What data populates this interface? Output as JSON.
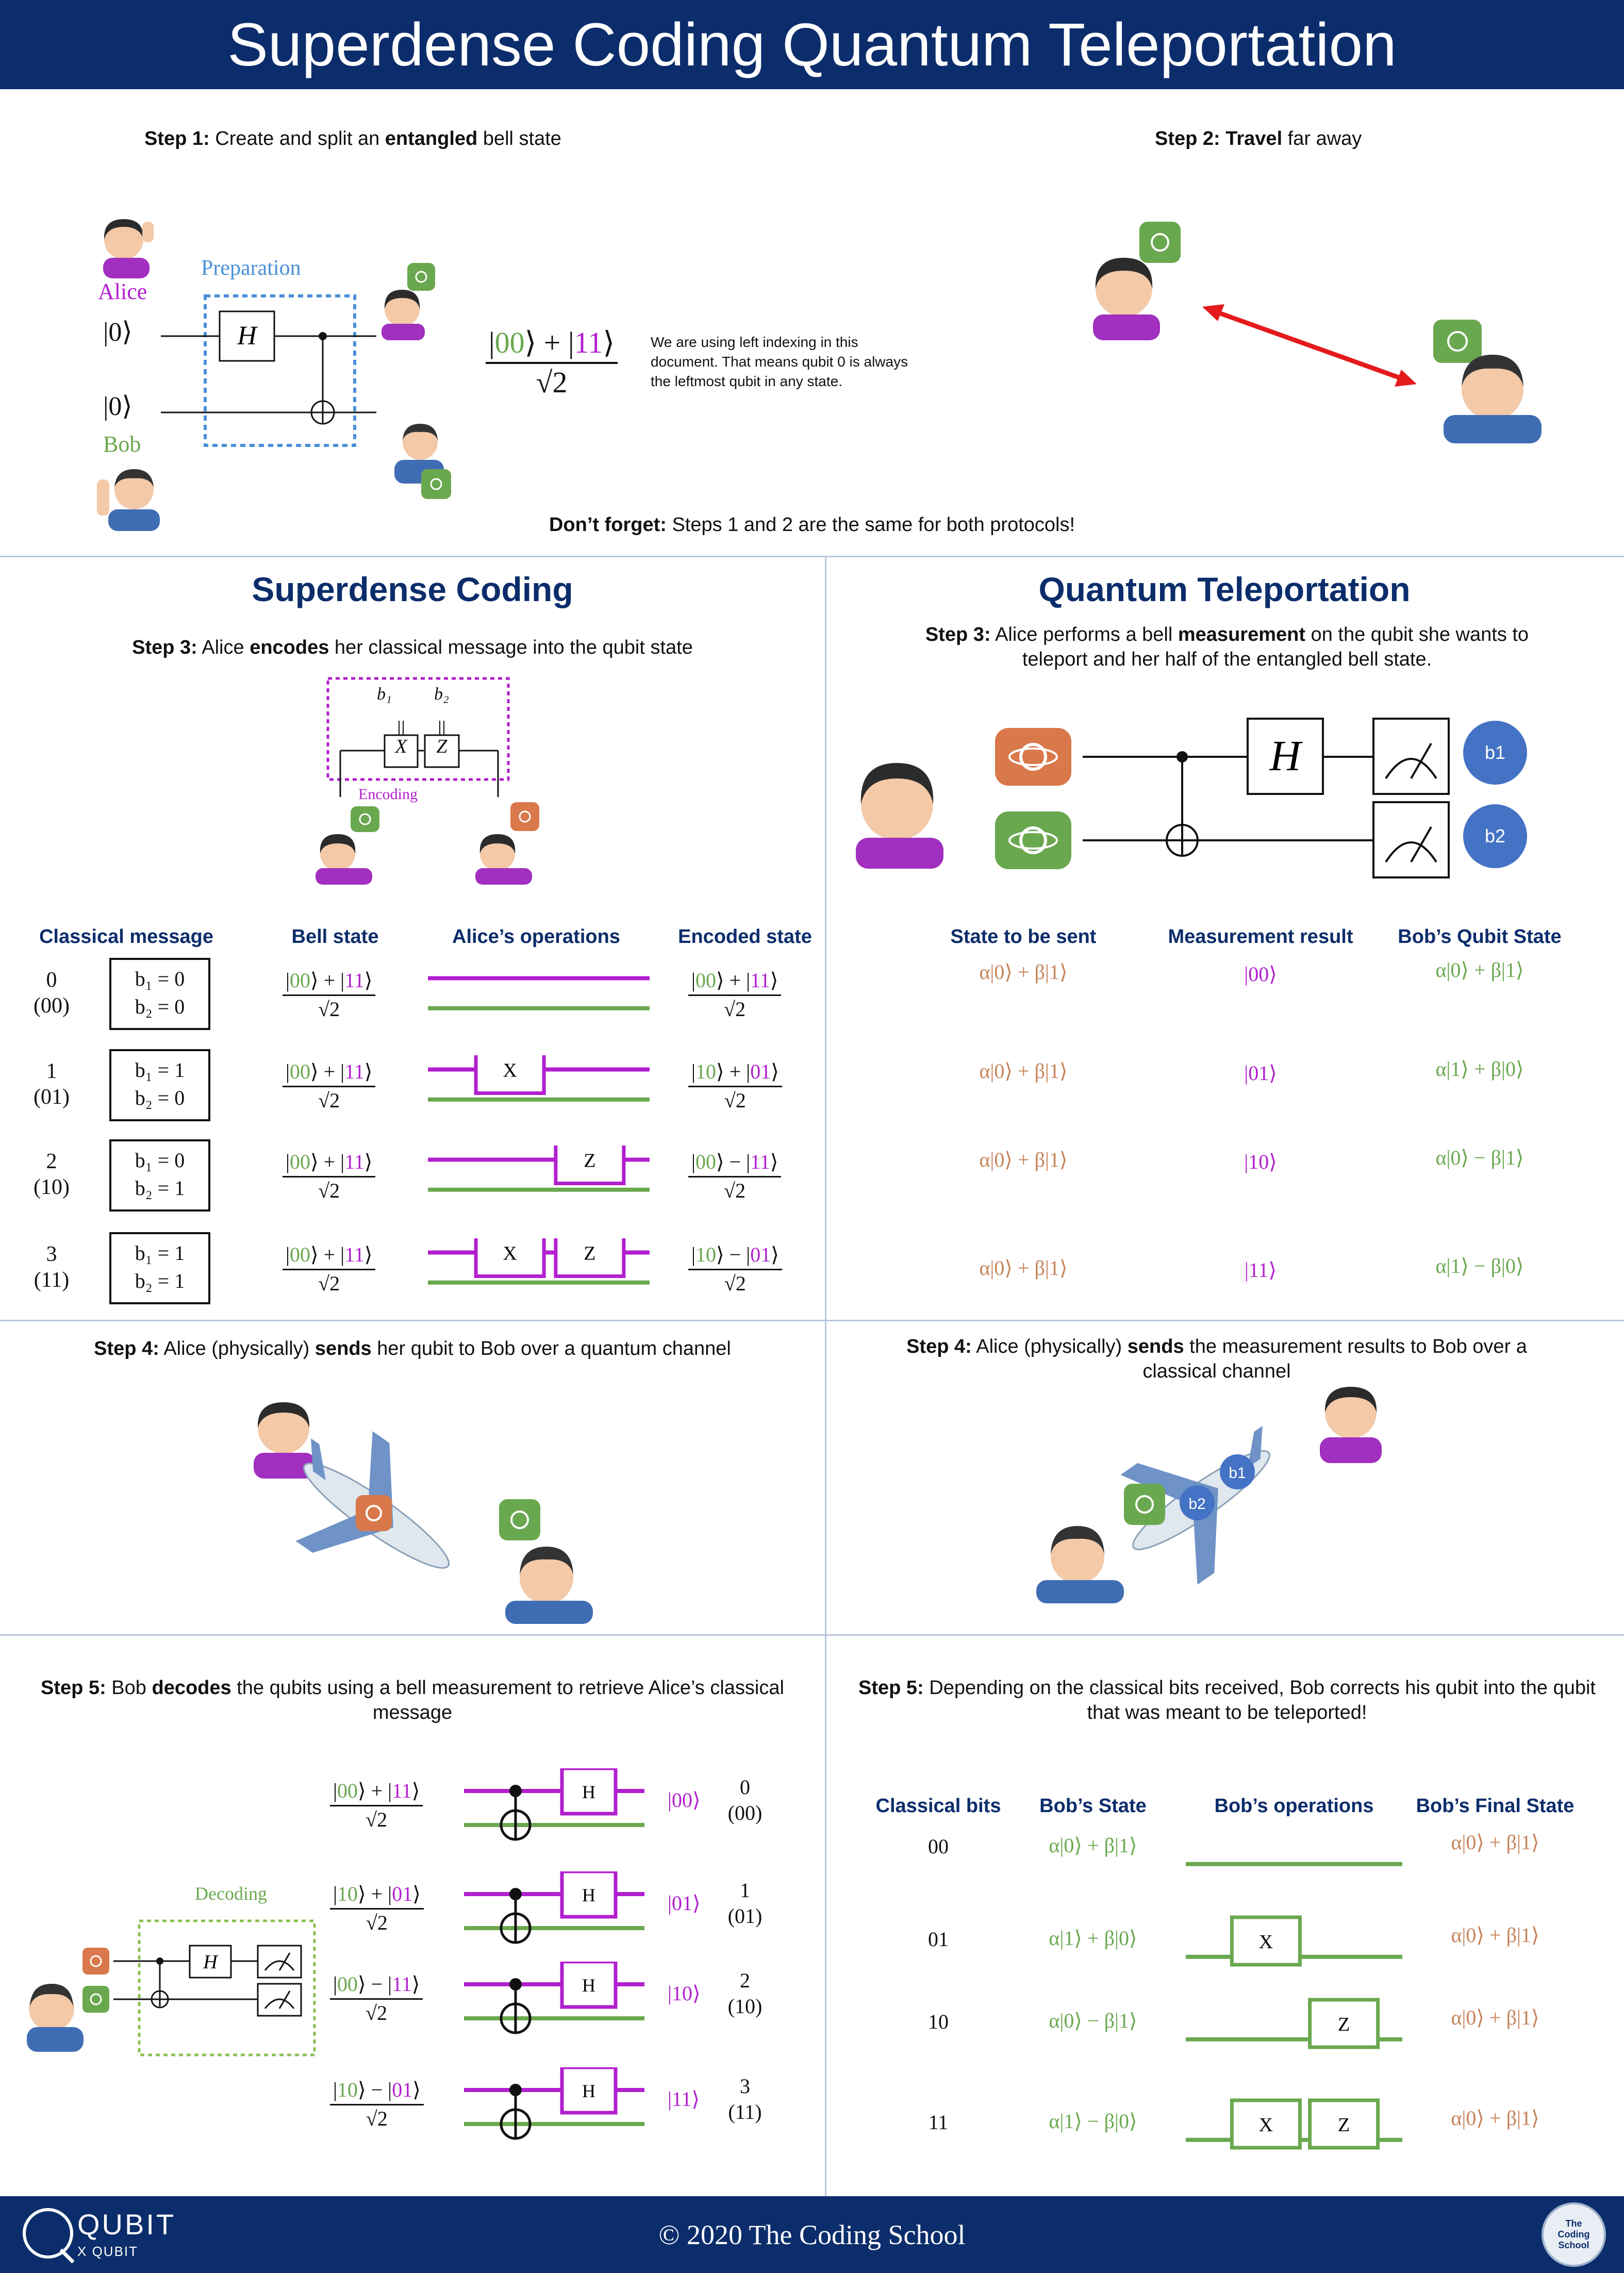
{
  "title": "Superdense Coding Quantum Teleportation",
  "top": {
    "step1": {
      "label": "Step 1:",
      "pre": " Create and split an ",
      "bold": "entangled",
      "post": " bell state"
    },
    "step2": {
      "label": "Step 2:",
      "bold": " Travel",
      "post": " far away"
    },
    "prep_label": "Preparation",
    "alice": "Alice",
    "bob": "Bob",
    "ket0a": "|0⟩",
    "ket0b": "|0⟩",
    "gate_h": "H",
    "bell_num_parts": [
      "|",
      "00",
      "⟩ + |",
      "11",
      "⟩"
    ],
    "bell_den": "√2",
    "indexing_note": "We are using left indexing in this document. That means qubit 0 is always the leftmost qubit in any state.",
    "dont_forget": {
      "bold": "Don’t forget:",
      "text": " Steps 1 and 2 are the same for both protocols!"
    }
  },
  "sdc": {
    "title": "Superdense Coding",
    "step3": {
      "label": "Step 3:",
      "pre": " Alice ",
      "bold": "encodes",
      "post": " her classical message into the qubit state"
    },
    "encoding_label": "Encoding",
    "b1": "b₁",
    "b2": "b₂",
    "gate_x": "X",
    "gate_z": "Z",
    "headers": [
      "Classical message",
      "Bell state",
      "Alice’s operations",
      "Encoded state"
    ],
    "rows": [
      {
        "msg": "0",
        "bits": "(00)",
        "line1": "b₁ = 0",
        "line2": "b₂ = 0",
        "ops": "",
        "enc": [
          "|",
          "00",
          "⟩ + |",
          "11",
          "⟩"
        ]
      },
      {
        "msg": "1",
        "bits": "(01)",
        "line1": "b₁ = 1",
        "line2": "b₂ = 0",
        "ops": "X",
        "enc": [
          "|",
          "10",
          "⟩ + |",
          "01",
          "⟩"
        ]
      },
      {
        "msg": "2",
        "bits": "(10)",
        "line1": "b₁ = 0",
        "line2": "b₂ = 1",
        "ops": "Z",
        "enc": [
          "|",
          "00",
          "⟩ − |",
          "11",
          "⟩"
        ]
      },
      {
        "msg": "3",
        "bits": "(11)",
        "line1": "b₁ = 1",
        "line2": "b₂ = 1",
        "ops": "XZ",
        "enc": [
          "|",
          "10",
          "⟩ − |",
          "01",
          "⟩"
        ]
      }
    ],
    "bell_parts": [
      "|",
      "00",
      "⟩ + |",
      "11",
      "⟩"
    ],
    "step4": {
      "label": "Step 4:",
      "pre": " Alice (physically) ",
      "bold": "sends",
      "post": " her qubit to Bob over a quantum channel"
    },
    "step5": {
      "label": "Step 5:",
      "pre": " Bob ",
      "bold": "decodes",
      "post": " the qubits using a bell measurement to retrieve Alice’s classical message"
    },
    "decoding_label": "Decoding",
    "decode_rows": [
      {
        "state": [
          "|",
          "00",
          "⟩ + |",
          "11",
          "⟩"
        ],
        "result": "|00⟩",
        "msg": "0",
        "bits": "(00)"
      },
      {
        "state": [
          "|",
          "10",
          "⟩ + |",
          "01",
          "⟩"
        ],
        "result": "|01⟩",
        "msg": "1",
        "bits": "(01)"
      },
      {
        "state": [
          "|",
          "00",
          "⟩ − |",
          "11",
          "⟩"
        ],
        "result": "|10⟩",
        "msg": "2",
        "bits": "(10)"
      },
      {
        "state": [
          "|",
          "10",
          "⟩ − |",
          "01",
          "⟩"
        ],
        "result": "|11⟩",
        "msg": "3",
        "bits": "(11)"
      }
    ]
  },
  "qt": {
    "title": "Quantum Teleportation",
    "step3": {
      "label": "Step 3:",
      "pre": " Alice performs a bell ",
      "bold": "measurement",
      "post": " on the qubit she wants to teleport and her half of the entangled bell state."
    },
    "b1": "b1",
    "b2": "b2",
    "headers": [
      "State to be sent",
      "Measurement result",
      "Bob’s Qubit State"
    ],
    "rows": [
      {
        "sent": "α|0⟩ + β|1⟩",
        "result": "|00⟩",
        "bob": "α|0⟩ + β|1⟩"
      },
      {
        "sent": "α|0⟩ + β|1⟩",
        "result": "|01⟩",
        "bob": "α|1⟩ + β|0⟩"
      },
      {
        "sent": "α|0⟩ + β|1⟩",
        "result": "|10⟩",
        "bob": "α|0⟩ − β|1⟩"
      },
      {
        "sent": "α|0⟩ + β|1⟩",
        "result": "|11⟩",
        "bob": "α|1⟩ − β|0⟩"
      }
    ],
    "step4": {
      "label": "Step 4:",
      "pre": " Alice (physically) ",
      "bold": "sends",
      "post": " the measurement results to Bob over a classical channel"
    },
    "step5": {
      "label": "Step 5:",
      "pre": " Depending on the classical bits received, Bob corrects his qubit into the qubit that was meant to be teleported!"
    },
    "corr_headers": [
      "Classical bits",
      "Bob’s State",
      "Bob’s operations",
      "Bob’s Final State"
    ],
    "corr_rows": [
      {
        "bits": "00",
        "state": "α|0⟩ + β|1⟩",
        "ops": "",
        "final": "α|0⟩ + β|1⟩"
      },
      {
        "bits": "01",
        "state": "α|1⟩ + β|0⟩",
        "ops": "X",
        "final": "α|0⟩ + β|1⟩"
      },
      {
        "bits": "10",
        "state": "α|0⟩ − β|1⟩",
        "ops": "Z",
        "final": "α|0⟩ + β|1⟩"
      },
      {
        "bits": "11",
        "state": "α|1⟩ − β|0⟩",
        "ops": "XZ",
        "final": "α|0⟩ + β|1⟩"
      }
    ]
  },
  "footer": {
    "copyright": "© 2020 The Coding School",
    "logo_main": "QUBIT",
    "logo_sub": "X QUBIT",
    "school_logo": "The Coding School"
  },
  "colors": {
    "navy": "#0c2d6b",
    "purple": "#b21fcf",
    "green": "#6aa84f",
    "orange": "#c7835a",
    "blue": "#4472c4",
    "red": "#e41a1c"
  }
}
